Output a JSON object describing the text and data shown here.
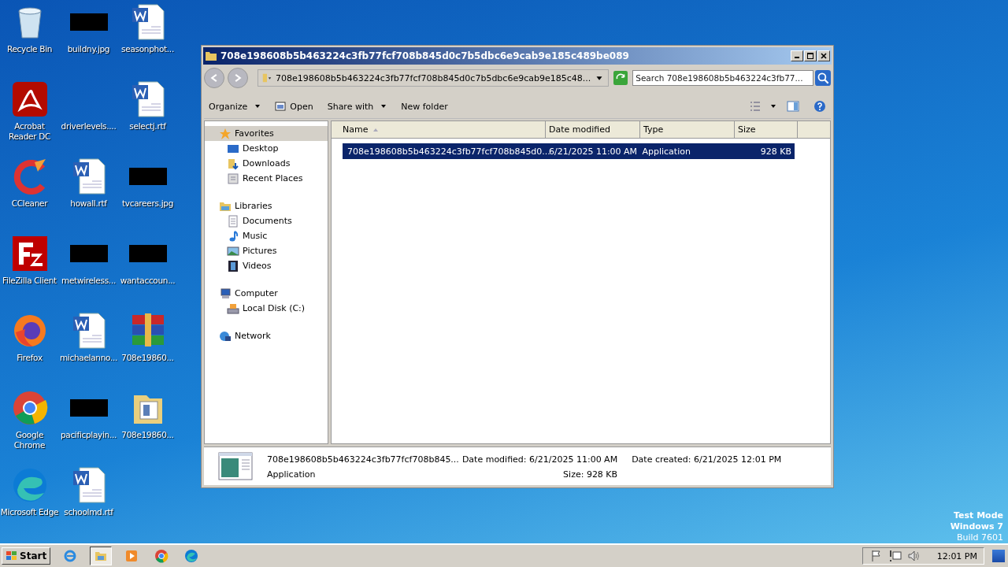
{
  "desktop_icons": [
    {
      "label": "Recycle Bin",
      "kind": "recycle"
    },
    {
      "label": "Acrobat Reader DC",
      "kind": "pdf"
    },
    {
      "label": "CCleaner",
      "kind": "ccleaner"
    },
    {
      "label": "FileZilla Client",
      "kind": "filezilla"
    },
    {
      "label": "Firefox",
      "kind": "firefox"
    },
    {
      "label": "Google Chrome",
      "kind": "chrome"
    },
    {
      "label": "Microsoft Edge",
      "kind": "edge"
    },
    {
      "label": "buildny.jpg",
      "kind": "redacted"
    },
    {
      "label": "driverlevels....",
      "kind": "blank"
    },
    {
      "label": "howall.rtf",
      "kind": "word"
    },
    {
      "label": "metwireless...",
      "kind": "redacted"
    },
    {
      "label": "michaelanno...",
      "kind": "word"
    },
    {
      "label": "pacificplayin...",
      "kind": "redacted"
    },
    {
      "label": "schoolmd.rtf",
      "kind": "word"
    },
    {
      "label": "seasonphot...",
      "kind": "word"
    },
    {
      "label": "selectj.rtf",
      "kind": "word"
    },
    {
      "label": "tvcareers.jpg",
      "kind": "redacted"
    },
    {
      "label": "wantaccoun...",
      "kind": "redacted"
    },
    {
      "label": "708e19860...",
      "kind": "winrar"
    },
    {
      "label": "708e19860...",
      "kind": "folder"
    }
  ],
  "window": {
    "title": "708e198608b5b463224c3fb77fcf708b845d0c7b5dbc6e9cab9e185c489be089",
    "address": "708e198608b5b463224c3fb77fcf708b845d0c7b5dbc6e9cab9e185c48...",
    "search": {
      "placeholder": "Search 708e198608b5b463224c3fb77..."
    },
    "toolbar": [
      {
        "label": "Organize",
        "dropdown": true,
        "kind": "plain"
      },
      {
        "label": "Open",
        "dropdown": false,
        "kind": "open"
      },
      {
        "label": "Share with",
        "dropdown": true,
        "kind": "plain"
      },
      {
        "label": "New folder",
        "dropdown": false,
        "kind": "plain"
      }
    ],
    "nav": [
      {
        "label": "Favorites",
        "kind": "star",
        "selected": true,
        "children": [
          {
            "label": "Desktop",
            "kind": "desktop",
            "selected": false
          },
          {
            "label": "Downloads",
            "kind": "downloads",
            "selected": false
          },
          {
            "label": "Recent Places",
            "kind": "recent",
            "selected": false
          }
        ]
      },
      {
        "label": "Libraries",
        "kind": "libraries",
        "selected": false,
        "children": [
          {
            "label": "Documents",
            "kind": "documents",
            "selected": false
          },
          {
            "label": "Music",
            "kind": "music",
            "selected": false
          },
          {
            "label": "Pictures",
            "kind": "pictures",
            "selected": false
          },
          {
            "label": "Videos",
            "kind": "videos",
            "selected": false
          }
        ]
      },
      {
        "label": "Computer",
        "kind": "computer",
        "selected": false,
        "children": [
          {
            "label": "Local Disk (C:)",
            "kind": "disk",
            "selected": false
          }
        ]
      },
      {
        "label": "Network",
        "kind": "network",
        "selected": false
      }
    ],
    "columns": [
      "Name",
      "Date modified",
      "Type",
      "Size"
    ],
    "files": [
      {
        "name": "708e198608b5b463224c3fb77fcf708b845d0...",
        "date": "6/21/2025 11:00 AM",
        "type": "Application",
        "size": "928 KB",
        "selected": true
      }
    ],
    "details": {
      "name": "708e198608b5b463224c3fb77fcf708b845...",
      "type": "Application",
      "modified_label": "Date modified:",
      "modified": "6/21/2025 11:00 AM",
      "size_label": "Size:",
      "size": "928 KB",
      "created_label": "Date created:",
      "created": "6/21/2025 12:01 PM"
    }
  },
  "watermark_text": [
    "Test Mode",
    "Windows 7",
    "Build 7601"
  ],
  "taskbar": {
    "start": "Start",
    "apps": [
      {
        "kind": "ie",
        "selected": false
      },
      {
        "kind": "explorer",
        "selected": true
      },
      {
        "kind": "media",
        "selected": false
      },
      {
        "kind": "chrome",
        "selected": false
      },
      {
        "kind": "edge",
        "selected": false
      }
    ],
    "clock": "12:01 PM"
  }
}
